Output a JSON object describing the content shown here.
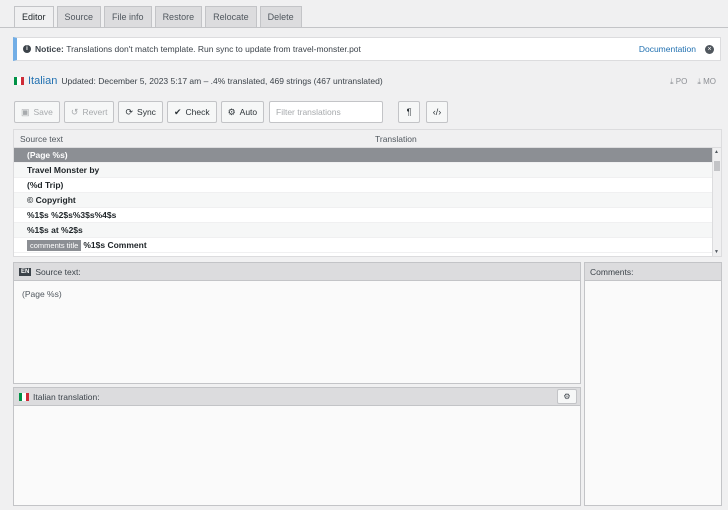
{
  "tabs": [
    "Editor",
    "Source",
    "File info",
    "Restore",
    "Relocate",
    "Delete"
  ],
  "notice": {
    "label": "Notice:",
    "text": "Translations don't match template. Run sync to update from travel-monster.pot",
    "link": "Documentation"
  },
  "language": {
    "name": "Italian",
    "status": "Updated: December 5, 2023 5:17 am – .4% translated, 469 strings (467 untranslated)",
    "download_po": "PO",
    "download_mo": "MO"
  },
  "toolbar": {
    "save": "Save",
    "revert": "Revert",
    "sync": "Sync",
    "check": "Check",
    "auto": "Auto",
    "filter_placeholder": "Filter translations"
  },
  "grid": {
    "col_source": "Source text",
    "col_translation": "Translation",
    "rows": [
      {
        "context": "",
        "text": "(Page %s)"
      },
      {
        "context": "",
        "text": "Travel Monster by"
      },
      {
        "context": "",
        "text": "(%d Trip)"
      },
      {
        "context": "",
        "text": "© Copyright"
      },
      {
        "context": "",
        "text": "%1$s %2$s%3$s%4$s"
      },
      {
        "context": "",
        "text": "%1$s at %2$s"
      },
      {
        "context": "comments title",
        "text": "%1$s Comment"
      }
    ]
  },
  "source_panel": {
    "badge": "EN",
    "label": "Source text:",
    "value": "(Page %s)"
  },
  "translation_panel": {
    "label": "Italian translation:"
  },
  "comments_panel": {
    "label": "Comments:"
  },
  "colors": {
    "accent": "#2271b1",
    "notice_border": "#72aee6",
    "selected_row": "#8c8f94",
    "flag_green": "#009246",
    "flag_white": "#ffffff",
    "flag_red": "#ce2b37"
  },
  "icons": {
    "notice": "info-icon",
    "close": "close-icon",
    "download": "download-icon",
    "save": "save-icon",
    "revert": "revert-icon",
    "sync": "sync-icon",
    "check": "check-icon",
    "auto": "robot-icon",
    "pilcrow": "pilcrow-icon",
    "code": "code-icon"
  }
}
